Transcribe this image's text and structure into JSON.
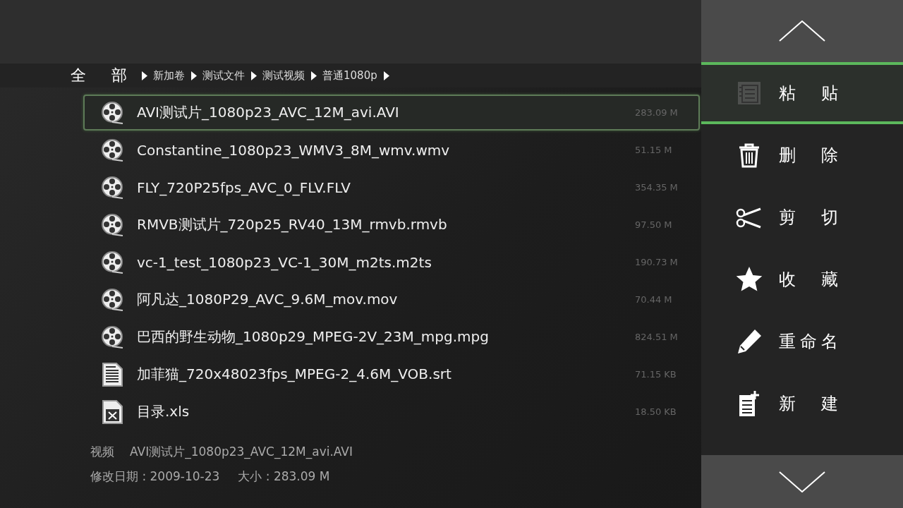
{
  "breadcrumb": [
    {
      "label": "全部",
      "kind": "root"
    },
    {
      "label": "新加卷",
      "kind": "folder"
    },
    {
      "label": "测试文件",
      "kind": "folder"
    },
    {
      "label": "测试视频",
      "kind": "folder"
    },
    {
      "label": "普通1080p",
      "kind": "folder"
    }
  ],
  "files": [
    {
      "name": "AVI测试片_1080p23_AVC_12M_avi.AVI",
      "size": "283.09 M",
      "kind": "video",
      "selected": true
    },
    {
      "name": "Constantine_1080p23_WMV3_8M_wmv.wmv",
      "size": "51.15 M",
      "kind": "video",
      "selected": false
    },
    {
      "name": "FLY_720P25fps_AVC_0_FLV.FLV",
      "size": "354.35 M",
      "kind": "video",
      "selected": false
    },
    {
      "name": "RMVB测试片_720p25_RV40_13M_rmvb.rmvb",
      "size": "97.50 M",
      "kind": "video",
      "selected": false
    },
    {
      "name": "vc-1_test_1080p23_VC-1_30M_m2ts.m2ts",
      "size": "190.73 M",
      "kind": "video",
      "selected": false
    },
    {
      "name": "阿凡达_1080P29_AVC_9.6M_mov.mov",
      "size": "70.44 M",
      "kind": "video",
      "selected": false
    },
    {
      "name": "巴西的野生动物_1080p29_MPEG-2V_23M_mpg.mpg",
      "size": "824.51 M",
      "kind": "video",
      "selected": false
    },
    {
      "name": "加菲猫_720x48023fps_MPEG-2_4.6M_VOB.srt",
      "size": "71.15 KB",
      "kind": "document",
      "selected": false
    },
    {
      "name": "目录.xls",
      "size": "18.50 KB",
      "kind": "spreadsheet",
      "selected": false
    }
  ],
  "details": {
    "type_label": "视频",
    "file_name": "AVI测试片_1080p23_AVC_12M_avi.AVI",
    "modified": "修改日期 : 2009-10-23",
    "size": "大小 : 283.09 M"
  },
  "actions": [
    {
      "label": "粘贴",
      "kind": "paste",
      "selected": true,
      "disabled": true
    },
    {
      "label": "删除",
      "kind": "delete",
      "selected": false,
      "disabled": false
    },
    {
      "label": "剪切",
      "kind": "cut",
      "selected": false,
      "disabled": false
    },
    {
      "label": "收藏",
      "kind": "favorite",
      "selected": false,
      "disabled": false
    },
    {
      "label": "重命名",
      "kind": "rename",
      "selected": false,
      "disabled": false
    },
    {
      "label": "新建",
      "kind": "new",
      "selected": false,
      "disabled": false
    }
  ]
}
